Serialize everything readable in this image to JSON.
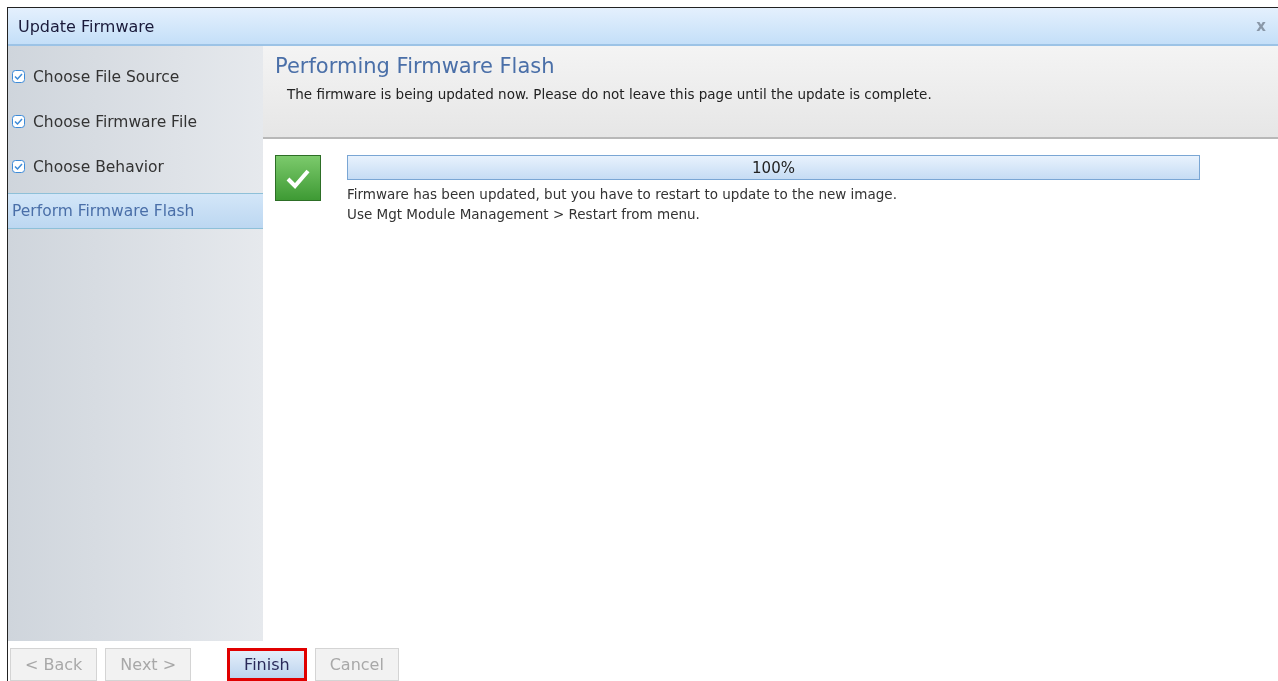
{
  "window": {
    "title": "Update Firmware",
    "close": "x"
  },
  "steps": [
    {
      "label": "Choose File Source",
      "checked": true,
      "selected": false
    },
    {
      "label": "Choose Firmware File",
      "checked": true,
      "selected": false
    },
    {
      "label": "Choose Behavior",
      "checked": true,
      "selected": false
    },
    {
      "label": "Perform Firmware Flash",
      "checked": false,
      "selected": true
    }
  ],
  "page": {
    "title": "Performing Firmware Flash",
    "description": "The firmware is being updated now. Please do not leave this page until the update is complete."
  },
  "progress": {
    "level": 1,
    "reading": "100%",
    "done": true,
    "messages": [
      "Firmware has been updated, but you have to restart to update to the new image.",
      "Use Mgt Module Management > Restart from menu."
    ]
  },
  "buttons": [
    {
      "label": "< Back",
      "disabled": true,
      "highlighted": false
    },
    {
      "label": "Next >",
      "disabled": true,
      "highlighted": false
    },
    {
      "label": "Finish",
      "disabled": false,
      "highlighted": true
    },
    {
      "label": "Cancel",
      "disabled": true,
      "highlighted": false
    }
  ]
}
